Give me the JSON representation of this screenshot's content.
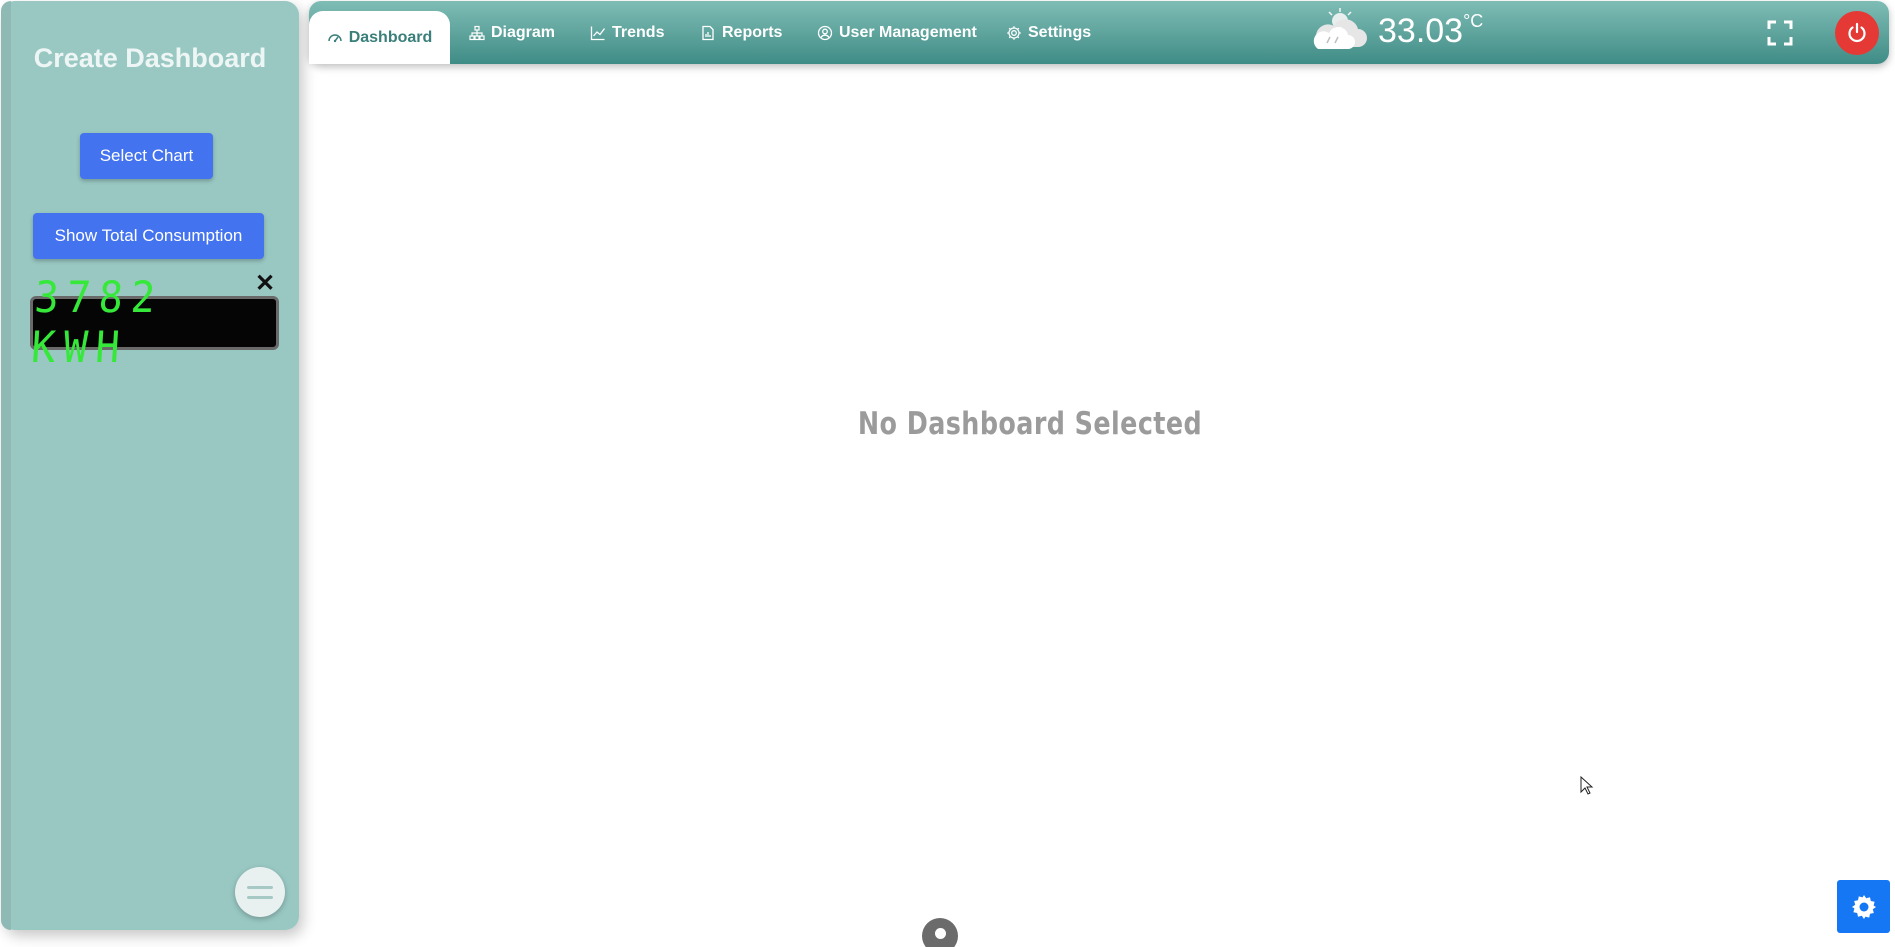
{
  "sidebar": {
    "title": "Create Dashboard",
    "select_chart_label": "Select Chart",
    "total_consumption_label": "Show Total Consumption",
    "close_glyph": "✕",
    "consumption_display": "3782 KWH"
  },
  "nav": {
    "tabs": [
      {
        "label": "Dashboard",
        "icon": "gauge-icon",
        "active": true
      },
      {
        "label": "Diagram",
        "icon": "diagram-icon",
        "active": false
      },
      {
        "label": "Trends",
        "icon": "trend-chart-icon",
        "active": false
      },
      {
        "label": "Reports",
        "icon": "report-icon",
        "active": false
      },
      {
        "label": "User Management",
        "icon": "user-circle-icon",
        "active": false
      },
      {
        "label": "Settings",
        "icon": "gear-icon",
        "active": false
      }
    ]
  },
  "weather": {
    "icon": "cloud-rain-sun-icon",
    "temperature": "33.03",
    "unit": "°C"
  },
  "main": {
    "empty_message": "No Dashboard Selected"
  },
  "colors": {
    "sidebar_bg": "#99c8c3",
    "topbar_top": "#7fbdb5",
    "topbar_bottom": "#3f8c86",
    "button_blue": "#4473ef",
    "lcd_green": "#35e83a",
    "power_red": "#e53935",
    "settings_blue": "#1677f5"
  }
}
